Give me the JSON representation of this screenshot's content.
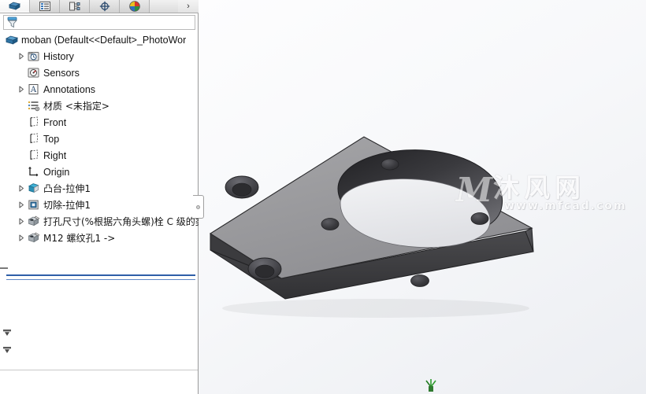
{
  "window": {
    "title": "moban  (Default<<Default>_PhotoWor"
  },
  "tabstrip": {
    "tabs": [
      {
        "id": "feature-manager",
        "icon": "solid-part-icon",
        "label": "FeatureManager Design Tree",
        "active": true
      },
      {
        "id": "property-manager",
        "icon": "property-list-icon",
        "label": "PropertyManager",
        "active": false
      },
      {
        "id": "configuration-manager",
        "icon": "configuration-icon",
        "label": "ConfigurationManager",
        "active": false
      },
      {
        "id": "dimxpert-manager",
        "icon": "dimxpert-crosshair-icon",
        "label": "DimXpertManager",
        "active": false
      },
      {
        "id": "display-manager",
        "icon": "color-wheel-icon",
        "label": "DisplayManager",
        "active": false
      }
    ],
    "overflow_label": "›"
  },
  "filter": {
    "icon": "filter-funnel-icon",
    "value": "",
    "placeholder": ""
  },
  "tree": {
    "root": {
      "label": "moban  (Default<<Default>_PhotoWor",
      "icon": "part-icon",
      "indent": 0,
      "twisty": "none"
    },
    "items": [
      {
        "label": "History",
        "icon": "history-icon",
        "indent": 1,
        "twisty": "collapsed",
        "cjk": false
      },
      {
        "label": "Sensors",
        "icon": "sensors-icon",
        "indent": 1,
        "twisty": "none",
        "cjk": false
      },
      {
        "label": "Annotations",
        "icon": "annotations-icon",
        "indent": 1,
        "twisty": "collapsed",
        "cjk": false
      },
      {
        "label": "材质 <未指定>",
        "icon": "material-icon",
        "indent": 1,
        "twisty": "none",
        "cjk": true
      },
      {
        "label": "Front",
        "icon": "plane-icon",
        "indent": 1,
        "twisty": "none",
        "cjk": false
      },
      {
        "label": "Top",
        "icon": "plane-icon",
        "indent": 1,
        "twisty": "none",
        "cjk": false
      },
      {
        "label": "Right",
        "icon": "plane-icon",
        "indent": 1,
        "twisty": "none",
        "cjk": false
      },
      {
        "label": "Origin",
        "icon": "origin-icon",
        "indent": 1,
        "twisty": "none",
        "cjk": false
      },
      {
        "label": "凸台-拉伸1",
        "icon": "boss-extrude-icon",
        "indent": 1,
        "twisty": "collapsed",
        "cjk": true
      },
      {
        "label": "切除-拉伸1",
        "icon": "cut-extrude-icon",
        "indent": 1,
        "twisty": "collapsed",
        "cjk": true
      },
      {
        "label": "打孔尺寸(%根据六角头螺)栓 C 级的类",
        "icon": "hole-wizard-icon",
        "indent": 1,
        "twisty": "collapsed",
        "cjk": true
      },
      {
        "label": "M12 螺纹孔1 ->",
        "icon": "hole-wizard-icon",
        "indent": 1,
        "twisty": "collapsed",
        "cjk": true
      }
    ],
    "rollback_bar": {
      "name": "rollback-bar",
      "color": "#2f5fa8"
    }
  },
  "viewport": {
    "watermark": {
      "logo": "M",
      "text_cn": "沐风网",
      "url": "www.mfcad.com"
    },
    "origin_triad": {
      "color": "#1f7a1f",
      "label": "Y"
    },
    "model": {
      "name": "rectangular-mounting-plate",
      "description": "Rectangular plate with large central through bore, four small through holes and two counterbored holes",
      "face_top_color": "#9a9a9d",
      "face_front_color": "#3d3d40",
      "face_side_color": "#58585c",
      "bore_inner_color": "#2e2e31",
      "edge_color": "#2a2a2c"
    }
  },
  "panel_controls": {
    "flyout_arrows": [
      {
        "name": "flyout-arrow-top",
        "icon": "flyout-arrow-icon"
      },
      {
        "name": "flyout-arrow-bottom",
        "icon": "flyout-arrow-icon"
      }
    ],
    "splitter": {
      "name": "panel-splitter-handle",
      "icon": "splitter-dot-icon"
    }
  },
  "colors": {
    "accent": "#2f5fa8",
    "panel_bg": "#ffffff",
    "tab_bg": "#dcdcdc",
    "viewport_bg_top": "#fdfdfe",
    "viewport_bg_bottom": "#eceef2"
  }
}
